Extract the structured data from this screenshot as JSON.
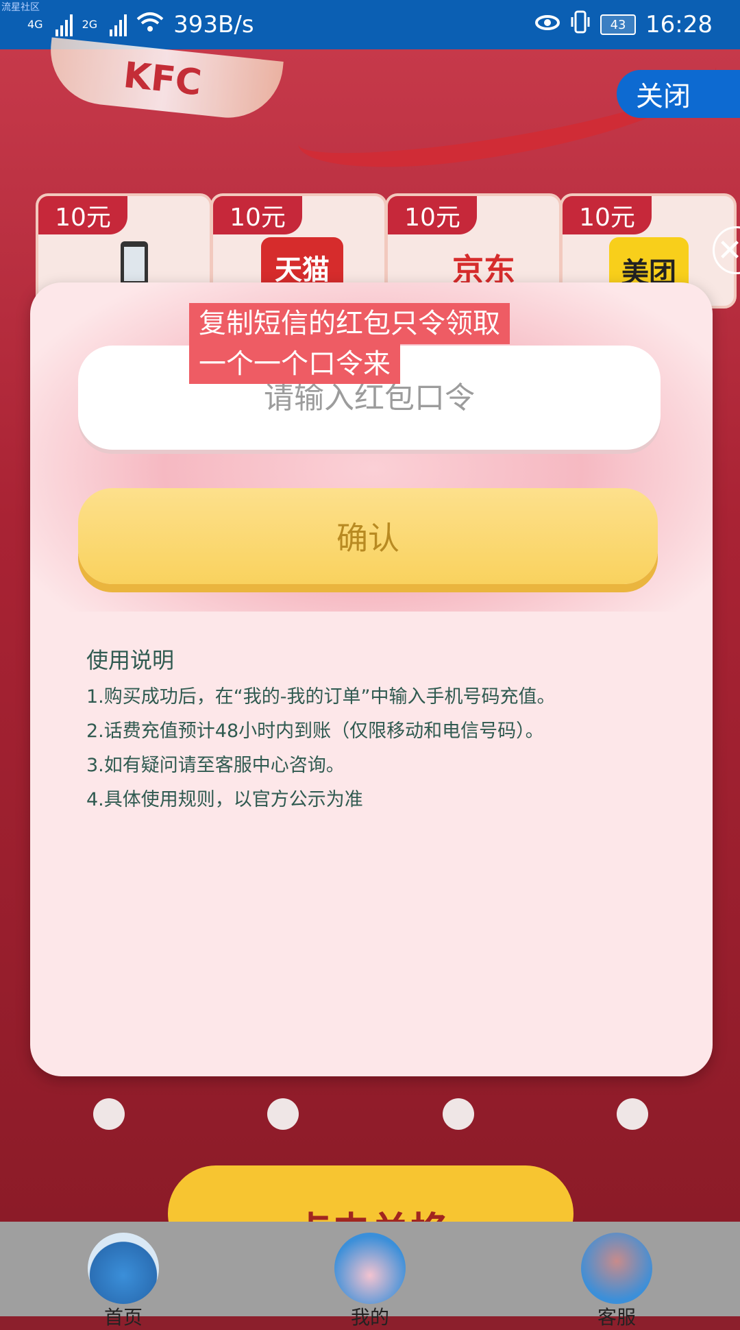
{
  "statusbar": {
    "watermark": "流星社区",
    "net1": "4G",
    "net2": "2G",
    "speed": "393B/s",
    "battery": "43",
    "time": "16:28"
  },
  "header": {
    "close_label": "关闭"
  },
  "coupons": [
    {
      "amount": "10元",
      "brand": ""
    },
    {
      "amount": "10元",
      "brand": "天猫"
    },
    {
      "amount": "10元",
      "brand": "京东"
    },
    {
      "amount": "10元",
      "brand": "美团"
    }
  ],
  "modal": {
    "overlay_line1": "复制短信的红包只令领取",
    "overlay_line2": "一个一个口令来",
    "input_placeholder": "请输入红包口令",
    "confirm_label": "确认",
    "instructions_title": "使用说明",
    "instructions": [
      "1.购买成功后，在“我的-我的订单”中输入手机号码充值。",
      "2.话费充值预计48小时内到账（仅限移动和电信号码）。",
      "3.如有疑问请至客服中心咨询。",
      "4.具体使用规则，以官方公示为准"
    ]
  },
  "exchange_button": "点击兑换",
  "bottom_nav": [
    {
      "label": "首页",
      "color": "#3b8fd9"
    },
    {
      "label": "我的",
      "color": "#3b8fd9"
    },
    {
      "label": "客服",
      "color": "#3b8fd9"
    }
  ]
}
